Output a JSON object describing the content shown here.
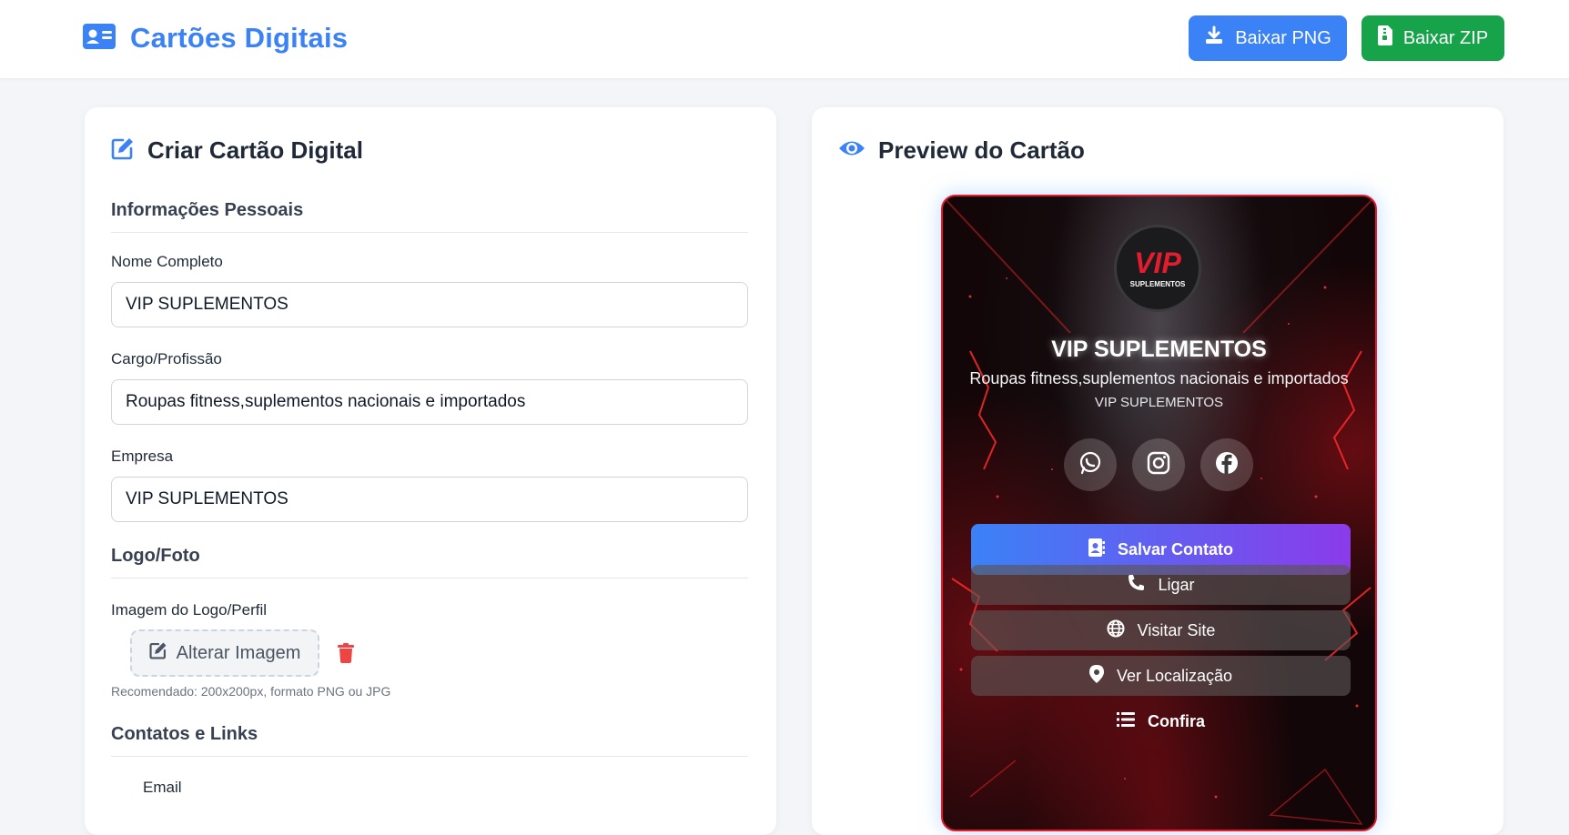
{
  "header": {
    "title": "Cartões Digitais",
    "download_png": "Baixar PNG",
    "download_zip": "Baixar ZIP"
  },
  "form": {
    "heading": "Criar Cartão Digital",
    "personal_section": "Informações Pessoais",
    "name_label": "Nome Completo",
    "name_value": "VIP SUPLEMENTOS",
    "role_label": "Cargo/Profissão",
    "role_value": "Roupas fitness,suplementos nacionais e importados",
    "company_label": "Empresa",
    "company_value": "VIP SUPLEMENTOS",
    "logo_section": "Logo/Foto",
    "logo_label": "Imagem do Logo/Perfil",
    "change_image": "Alterar Imagem",
    "logo_hint": "Recomendado: 200x200px, formato PNG ou JPG",
    "contacts_section": "Contatos e Links",
    "email_label": "Email"
  },
  "preview": {
    "heading": "Preview do Cartão",
    "logo_text": "VIP",
    "logo_subtext": "SUPLEMENTOS",
    "name": "VIP SUPLEMENTOS",
    "role": "Roupas fitness,suplementos nacionais e importados",
    "company": "VIP SUPLEMENTOS",
    "social": [
      "whatsapp-icon",
      "instagram-icon",
      "facebook-icon"
    ],
    "save_contact": "Salvar Contato",
    "buttons": {
      "call": "Ligar",
      "site": "Visitar Site",
      "location": "Ver Localização",
      "more": "Confira"
    }
  },
  "colors": {
    "primary": "#3b82f6",
    "success": "#16a34a",
    "danger": "#e11d2e",
    "gradient_end": "#8b3bea"
  }
}
